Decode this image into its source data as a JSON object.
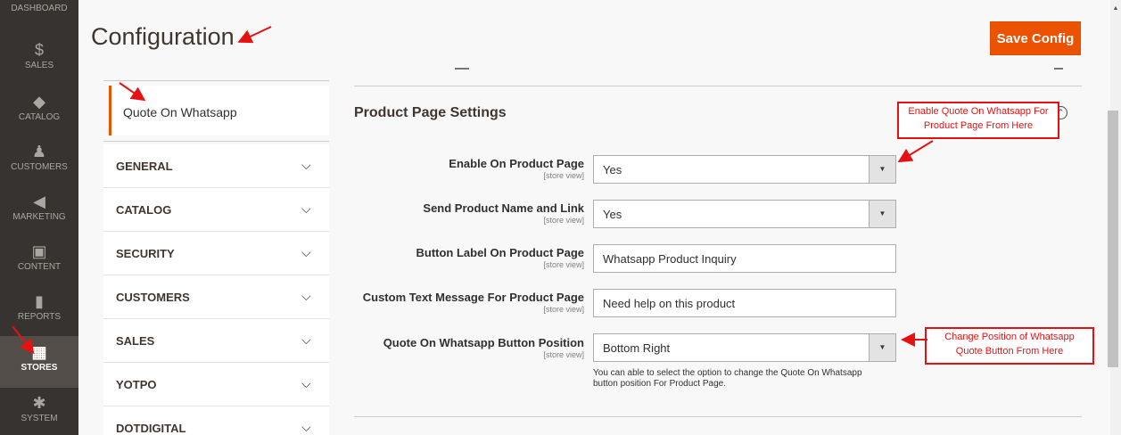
{
  "sidebar": {
    "items": [
      {
        "name": "nav-dashboard",
        "icon": "dashboard-icon",
        "glyph": "▬",
        "label": "DASHBOARD",
        "active": false
      },
      {
        "name": "nav-sales",
        "icon": "dollar-icon",
        "glyph": "$",
        "label": "SALES",
        "active": false
      },
      {
        "name": "nav-catalog",
        "icon": "cube-icon",
        "glyph": "◆",
        "label": "CATALOG",
        "active": false
      },
      {
        "name": "nav-customers",
        "icon": "person-icon",
        "glyph": "♟",
        "label": "CUSTOMERS",
        "active": false
      },
      {
        "name": "nav-marketing",
        "icon": "megaphone-icon",
        "glyph": "◀",
        "label": "MARKETING",
        "active": false
      },
      {
        "name": "nav-content",
        "icon": "layout-icon",
        "glyph": "▣",
        "label": "CONTENT",
        "active": false
      },
      {
        "name": "nav-reports",
        "icon": "bar-chart-icon",
        "glyph": "▮",
        "label": "REPORTS",
        "active": false
      },
      {
        "name": "nav-stores",
        "icon": "store-icon",
        "glyph": "▦",
        "label": "STORES",
        "active": true
      },
      {
        "name": "nav-system",
        "icon": "gear-icon",
        "glyph": "✱",
        "label": "SYSTEM",
        "active": false
      }
    ]
  },
  "header": {
    "title": "Configuration",
    "save_label": "Save Config"
  },
  "tabs": {
    "active_label": "Quote On Whatsapp",
    "groups": [
      {
        "label": "GENERAL"
      },
      {
        "label": "CATALOG"
      },
      {
        "label": "SECURITY"
      },
      {
        "label": "CUSTOMERS"
      },
      {
        "label": "SALES"
      },
      {
        "label": "YOTPO"
      },
      {
        "label": "DOTDIGITAL"
      }
    ]
  },
  "section": {
    "title": "Product Page Settings",
    "fields": [
      {
        "label": "Enable On Product Page",
        "scope": "[store view]",
        "type": "select",
        "value": "Yes"
      },
      {
        "label": "Send Product Name and Link",
        "scope": "[store view]",
        "type": "select",
        "value": "Yes"
      },
      {
        "label": "Button Label On Product Page",
        "scope": "[store view]",
        "type": "text",
        "value": "Whatsapp Product Inquiry"
      },
      {
        "label": "Custom Text Message For Product Page",
        "scope": "[store view]",
        "type": "text",
        "value": "Need help on this product"
      },
      {
        "label": "Quote On Whatsapp Button Position",
        "scope": "[store view]",
        "type": "select",
        "value": "Bottom Right"
      }
    ],
    "note": "You can able to select the option to change the Quote On Whatsapp button position For Product Page."
  },
  "callouts": {
    "enable": "Enable Quote On Whatsapp For Product Page From Here",
    "position": "Change Position of Whatsapp Quote Button From Here"
  },
  "colors": {
    "accent": "#eb5202",
    "annotation": "#e81111",
    "sidebar_bg": "#373330"
  }
}
